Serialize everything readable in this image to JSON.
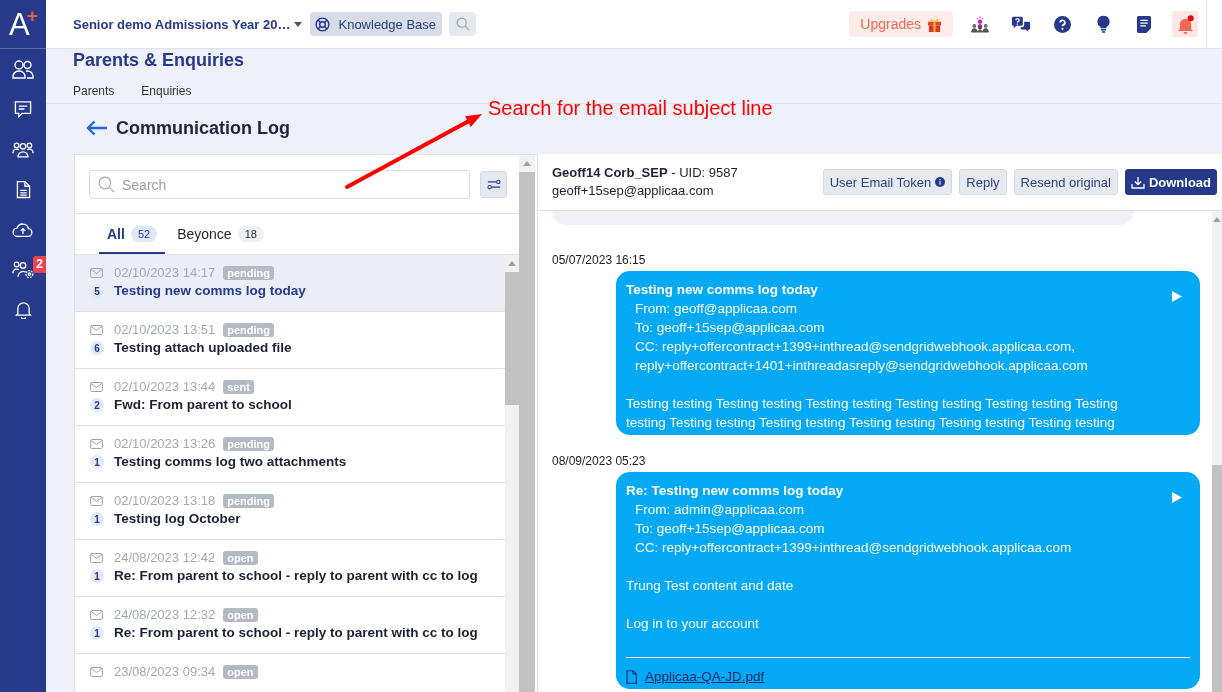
{
  "sidebar": {
    "logo": {
      "letter": "A",
      "mark": "+"
    },
    "items": [
      {
        "kind": "people"
      },
      {
        "kind": "chat"
      },
      {
        "kind": "group"
      },
      {
        "kind": "document"
      },
      {
        "kind": "cloud-upload"
      },
      {
        "kind": "group-settings",
        "badge": "2"
      },
      {
        "kind": "bell"
      }
    ]
  },
  "top_bar": {
    "workspace": "Senior demo Admissions Year 20…",
    "knowledge_base": "Knowledge Base",
    "upgrades": "Upgrades",
    "icons": [
      {
        "kind": "network",
        "alert": false
      },
      {
        "kind": "chat-help",
        "alert": false
      },
      {
        "kind": "help",
        "alert": false
      },
      {
        "kind": "lightbulb",
        "alert": false
      },
      {
        "kind": "notes",
        "alert": false
      },
      {
        "kind": "bell",
        "alert": true
      }
    ]
  },
  "page": {
    "title": "Parents & Enquiries",
    "tabs": [
      "Parents",
      "Enquiries"
    ]
  },
  "annotation": {
    "text": "Search for the email subject line"
  },
  "section": {
    "title": "Communication Log"
  },
  "list_panel": {
    "search": {
      "placeholder": "Search"
    },
    "tabs": [
      {
        "label": "All",
        "count": "52",
        "selected": true
      },
      {
        "label": "Beyonce",
        "count": "18",
        "selected": false
      }
    ],
    "messages": [
      {
        "date": "02/10/2023 14:17",
        "status": "pending",
        "count": "5",
        "subject": "Testing new comms log today",
        "selected": true
      },
      {
        "date": "02/10/2023 13:51",
        "status": "pending",
        "count": "6",
        "subject": "Testing attach uploaded file",
        "selected": false
      },
      {
        "date": "02/10/2023 13:44",
        "status": "sent",
        "count": "2",
        "subject": "Fwd: From parent to school",
        "selected": false
      },
      {
        "date": "02/10/2023 13:26",
        "status": "pending",
        "count": "1",
        "subject": "Testing comms log two attachments",
        "selected": false
      },
      {
        "date": "02/10/2023 13:18",
        "status": "pending",
        "count": "1",
        "subject": "Testing log October",
        "selected": false
      },
      {
        "date": "24/08/2023 12:42",
        "status": "open",
        "count": "1",
        "subject": "Re: From parent to school - reply to parent with cc to log",
        "selected": false
      },
      {
        "date": "24/08/2023 12:32",
        "status": "open",
        "count": "1",
        "subject": "Re: From parent to school - reply to parent with cc to log",
        "selected": false
      },
      {
        "date": "23/08/2023 09:34",
        "status": "open",
        "selected": false
      }
    ]
  },
  "detail": {
    "contact": "**Geoff14 Corb_SEP** - UID: 9587",
    "email": "geoff+15sep@applicaa.com",
    "buttons": [
      {
        "label": "User Email Token",
        "kind": "info"
      },
      {
        "label": "Reply",
        "kind": "plain"
      },
      {
        "label": "Resend original",
        "kind": "plain"
      },
      {
        "label": "Download",
        "kind": "download"
      }
    ],
    "thread": [
      {
        "date": "05/07/2023 16:15",
        "subject": "Testing new comms log today",
        "headers": [
          "From: geoff@applicaa.com",
          "To: geoff+15sep@applicaa.com",
          "CC: reply+offercontract+1399+inthread@sendgridwebhook.applicaa.com,",
          "reply+offercontract+1401+inthreadasreply@sendgridwebhook.applicaa.com"
        ],
        "body": [
          "Testing testing Testing testing Testing testing Testing testing Testing testing Testing testing Testing testing Testing testing Testing testing Testing testing Testing testing"
        ]
      },
      {
        "date": "08/09/2023 05:23",
        "subject": "Re: Testing new comms log today",
        "headers": [
          "From: admin@applicaa.com",
          "To: geoff+15sep@applicaa.com",
          "CC: reply+offercontract+1399+inthread@sendgridwebhook.applicaa.com"
        ],
        "body": [
          "Trung Test content and date",
          "Log in to your account"
        ],
        "attachments": [
          "Applicaa-QA-JD.pdf"
        ]
      }
    ]
  }
}
